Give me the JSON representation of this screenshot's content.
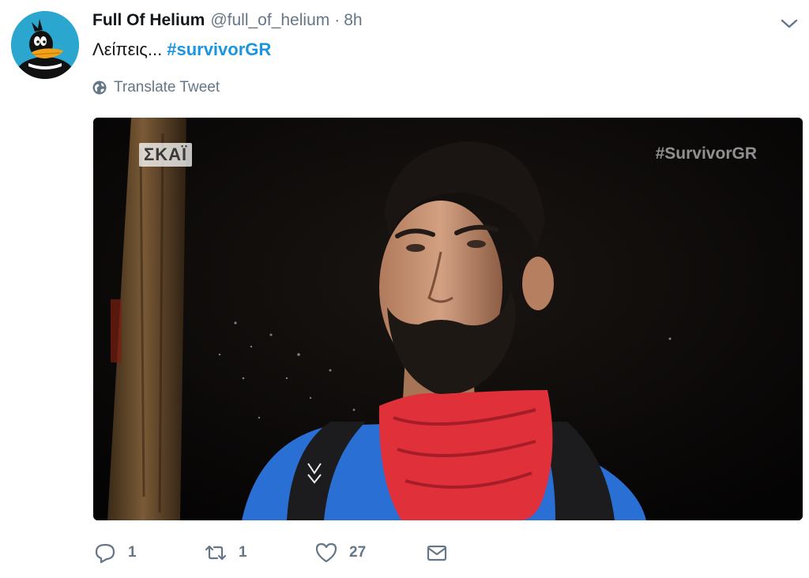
{
  "author": {
    "name": "Full Of Helium",
    "handle": "@full_of_helium",
    "separator": "·",
    "time": "8h"
  },
  "tweet": {
    "text": "Λείπεις...",
    "hashtag": "#survivorGR",
    "translate_label": "Translate Tweet"
  },
  "media": {
    "channel_logo": "ΣΚΑΪ",
    "hashtag_overlay": "#SurvivorGR"
  },
  "actions": {
    "reply_count": "1",
    "retweet_count": "1",
    "like_count": "27"
  },
  "colors": {
    "link": "#1b95e0",
    "muted": "#657786",
    "text": "#14171a"
  },
  "icons": [
    "daffy-duck-avatar",
    "chevron-down-icon",
    "globe-icon",
    "reply-icon",
    "retweet-icon",
    "heart-icon",
    "envelope-icon"
  ]
}
